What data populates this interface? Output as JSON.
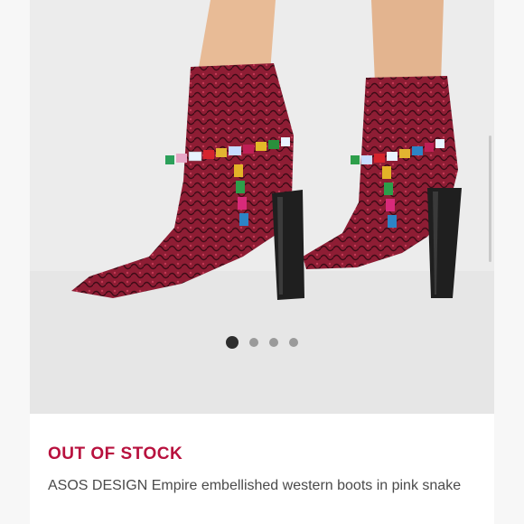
{
  "product": {
    "status": "OUT OF STOCK",
    "title": "ASOS DESIGN Empire embellished western boots in pink snake",
    "status_color": "#b8113e"
  },
  "gallery": {
    "image_count": 4,
    "active_index": 0
  }
}
